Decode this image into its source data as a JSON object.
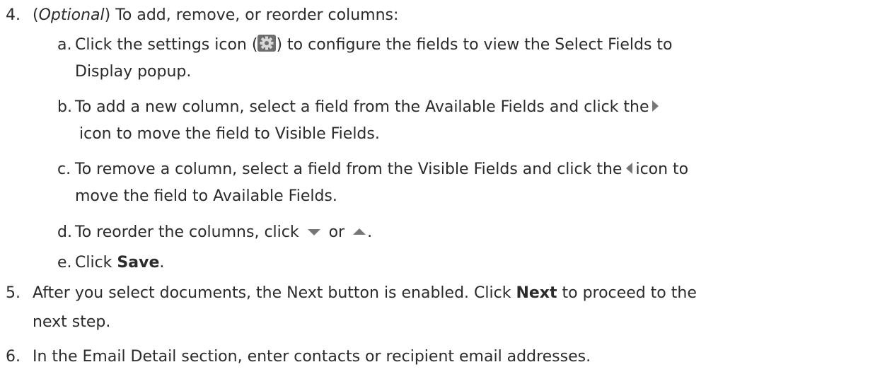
{
  "steps": {
    "s4": {
      "number": "4.",
      "paren_open": "(",
      "optional": "Optional",
      "text": ") To add, remove, or reorder columns:"
    },
    "a": {
      "letter": "a.",
      "pre": "Click the settings icon (",
      "post": ") to configure the fields to view the Select Fields to",
      "cont": "Display popup."
    },
    "b": {
      "letter": "b.",
      "pre": "To add a new column, select a field from the Available Fields and click the",
      "cont": "icon to move the field to Visible Fields."
    },
    "c": {
      "letter": "c.",
      "pre": "To remove a column, select a field from the Visible Fields and click the",
      "post": "icon to",
      "cont": "move the field to Available Fields."
    },
    "d": {
      "letter": "d.",
      "pre": "To reorder the columns, click",
      "mid": "or",
      "post": "."
    },
    "e": {
      "letter": "e.",
      "pre": "Click ",
      "bold": "Save",
      "post": "."
    },
    "s5": {
      "number": "5.",
      "pre": "After you select documents, the Next button is enabled. Click ",
      "bold": "Next",
      "post": " to proceed to the",
      "cont": "next step."
    },
    "s6": {
      "number": "6.",
      "text": "In the Email Detail section, enter contacts or recipient email addresses."
    }
  },
  "icons": {
    "settings": "gear-icon",
    "move_right": "move-right-arrow-icon",
    "move_left": "move-left-arrow-icon",
    "move_down": "move-down-arrow-icon",
    "move_up": "move-up-arrow-icon",
    "icon_color": "#777777"
  }
}
